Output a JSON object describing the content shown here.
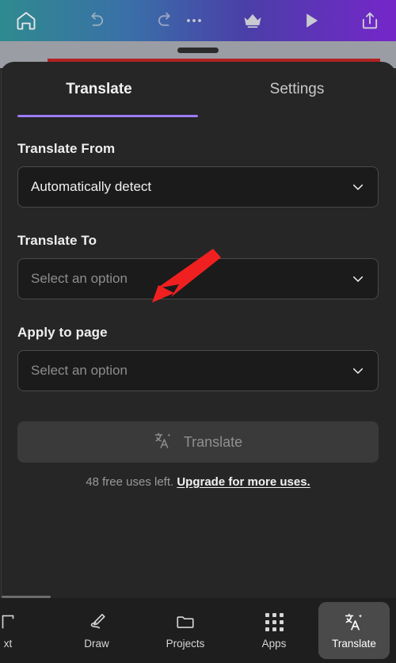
{
  "topbar": {
    "left_icons": [
      {
        "name": "home-icon",
        "label": "Home"
      },
      {
        "name": "undo-icon",
        "label": "Undo"
      },
      {
        "name": "redo-icon",
        "label": "Redo"
      }
    ],
    "right_icons": [
      {
        "name": "more-options-icon",
        "label": "More options"
      },
      {
        "name": "crown-icon",
        "label": "Premium"
      },
      {
        "name": "play-icon",
        "label": "Preview"
      },
      {
        "name": "share-icon",
        "label": "Share"
      }
    ]
  },
  "sheet": {
    "grabber": "drag-handle",
    "tabs": [
      {
        "label": "Translate",
        "active": true
      },
      {
        "label": "Settings",
        "active": false
      }
    ],
    "fields": {
      "translate_from": {
        "label": "Translate From",
        "value": "Automatically detect",
        "placeholder": "Select an option",
        "is_placeholder": false
      },
      "translate_to": {
        "label": "Translate To",
        "value": "Select an option",
        "placeholder": "Select an option",
        "is_placeholder": true
      },
      "apply_to_page": {
        "label": "Apply to page",
        "value": "Select an option",
        "placeholder": "Select an option",
        "is_placeholder": true
      }
    },
    "action": {
      "button_label": "Translate",
      "button_icon": "translate-icon",
      "button_enabled": false,
      "uses_text": "48 free uses left.",
      "upgrade_text": "Upgrade for more uses."
    }
  },
  "annotation": {
    "type": "arrow",
    "color": "#f02020",
    "points_to": "translate-to-dropdown"
  },
  "bottom_nav": [
    {
      "label": "xt",
      "full_label": "Text",
      "icon": "text-icon",
      "active": false,
      "clipped": true
    },
    {
      "label": "Draw",
      "icon": "draw-icon",
      "active": false,
      "clipped": false
    },
    {
      "label": "Projects",
      "icon": "folder-icon",
      "active": false,
      "clipped": false
    },
    {
      "label": "Apps",
      "icon": "apps-grid-icon",
      "active": false,
      "clipped": false
    },
    {
      "label": "Translate",
      "icon": "translate-icon",
      "active": true,
      "clipped": false
    }
  ],
  "colors": {
    "accent_purple": "#9b7bf5",
    "sheet_bg": "#262626",
    "field_bg": "#1b1b1b",
    "annotation_red": "#f02020",
    "red_line": "#b02222",
    "backdrop_grey": "#9a9da3"
  }
}
